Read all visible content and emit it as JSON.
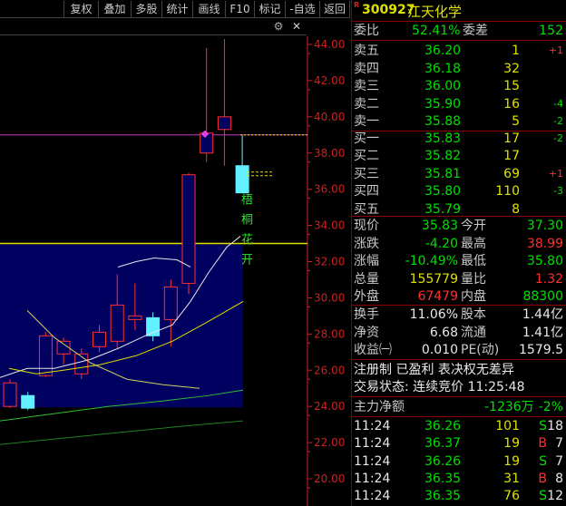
{
  "toolbar": {
    "items": [
      "复权",
      "叠加",
      "多股",
      "统计",
      "画线",
      "F10",
      "标记",
      "-自选",
      "返回"
    ]
  },
  "chart": {
    "price_axis": [
      "44.00",
      "42.00",
      "40.00",
      "38.00",
      "36.00",
      "34.00",
      "32.00",
      "30.00",
      "28.00",
      "26.00",
      "24.00",
      "22.00",
      "20.00"
    ],
    "vertical_text": [
      "梧",
      "桐",
      "花",
      "开"
    ],
    "candles": [
      {
        "o": 24.0,
        "c": 25.3,
        "h": 25.5,
        "l": 23.9
      },
      {
        "o": 24.6,
        "c": 23.9,
        "h": 24.8,
        "l": 23.8
      },
      {
        "o": 25.7,
        "c": 27.9,
        "h": 28.1,
        "l": 25.6
      },
      {
        "o": 26.9,
        "c": 27.6,
        "h": 27.8,
        "l": 26.3
      },
      {
        "o": 25.8,
        "c": 26.9,
        "h": 27.2,
        "l": 25.5
      },
      {
        "o": 27.3,
        "c": 28.1,
        "h": 28.5,
        "l": 27.0
      },
      {
        "o": 27.6,
        "c": 29.6,
        "h": 31.3,
        "l": 27.2
      },
      {
        "o": 28.8,
        "c": 29.0,
        "h": 30.8,
        "l": 28.2
      },
      {
        "o": 28.9,
        "c": 27.9,
        "h": 29.2,
        "l": 27.6
      },
      {
        "o": 28.8,
        "c": 30.6,
        "h": 31.0,
        "l": 27.3
      },
      {
        "o": 30.8,
        "c": 36.8,
        "h": 36.9,
        "l": 30.2
      },
      {
        "o": 38.0,
        "c": 39.1,
        "h": 43.8,
        "l": 37.5
      },
      {
        "o": 39.3,
        "c": 40.0,
        "h": 44.3,
        "l": 37.3
      },
      {
        "o": 37.3,
        "c": 35.8,
        "h": 38.99,
        "l": 35.8
      }
    ],
    "colors": {
      "up": "#ff3030",
      "down": "#60f0ff",
      "axis": "#d02020",
      "grid": "#404040",
      "box": "#000060"
    }
  },
  "quote": {
    "r_mark": "R",
    "code": "300927",
    "name": "江天化学",
    "weibi_label": "委比",
    "weibi": "52.41%",
    "weicha_label": "委差",
    "weicha": "152",
    "sell": [
      {
        "label": "卖五",
        "price": "36.20",
        "vol": "1",
        "chg": "+1"
      },
      {
        "label": "卖四",
        "price": "36.18",
        "vol": "32",
        "chg": ""
      },
      {
        "label": "卖三",
        "price": "36.00",
        "vol": "15",
        "chg": ""
      },
      {
        "label": "卖二",
        "price": "35.90",
        "vol": "16",
        "chg": "-4"
      },
      {
        "label": "卖一",
        "price": "35.88",
        "vol": "5",
        "chg": "-2"
      }
    ],
    "buy": [
      {
        "label": "买一",
        "price": "35.83",
        "vol": "17",
        "chg": "-2"
      },
      {
        "label": "买二",
        "price": "35.82",
        "vol": "17",
        "chg": ""
      },
      {
        "label": "买三",
        "price": "35.81",
        "vol": "69",
        "chg": "+1"
      },
      {
        "label": "买四",
        "price": "35.80",
        "vol": "110",
        "chg": "-3"
      },
      {
        "label": "买五",
        "price": "35.79",
        "vol": "8",
        "chg": ""
      }
    ],
    "stats": [
      {
        "l1": "现价",
        "v1": "35.83",
        "l2": "今开",
        "v2": "37.30"
      },
      {
        "l1": "涨跌",
        "v1": "-4.20",
        "l2": "最高",
        "v2": "38.99"
      },
      {
        "l1": "涨幅",
        "v1": "-10.49%",
        "l2": "最低",
        "v2": "35.80"
      },
      {
        "l1": "总量",
        "v1": "155779",
        "l2": "量比",
        "v2": "1.32"
      },
      {
        "l1": "外盘",
        "v1": "67479",
        "l2": "内盘",
        "v2": "88300"
      }
    ],
    "stats2": [
      {
        "l1": "换手",
        "v1": "11.06%",
        "l2": "股本",
        "v2": "1.44亿"
      },
      {
        "l1": "净资",
        "v1": "6.68",
        "l2": "流通",
        "v2": "1.41亿"
      },
      {
        "l1": "收益㈠",
        "v1": "0.010",
        "l2": "PE(动)",
        "v2": "1579.5"
      }
    ],
    "note1": "注册制 已盈利 表决权无差异",
    "note2": "交易状态: 连续竞价 11:25:48",
    "net_label": "主力净额",
    "net_value": "-1236万",
    "net_pct": "-2%",
    "trades": [
      {
        "time": "11:24",
        "price": "36.26",
        "vol": "101",
        "side": "S",
        "n": "18"
      },
      {
        "time": "11:24",
        "price": "36.37",
        "vol": "19",
        "side": "B",
        "n": "7"
      },
      {
        "time": "11:24",
        "price": "36.26",
        "vol": "19",
        "side": "S",
        "n": "7"
      },
      {
        "time": "11:24",
        "price": "36.35",
        "vol": "31",
        "side": "B",
        "n": "8"
      },
      {
        "time": "11:24",
        "price": "36.35",
        "vol": "76",
        "side": "S",
        "n": "12"
      }
    ]
  }
}
